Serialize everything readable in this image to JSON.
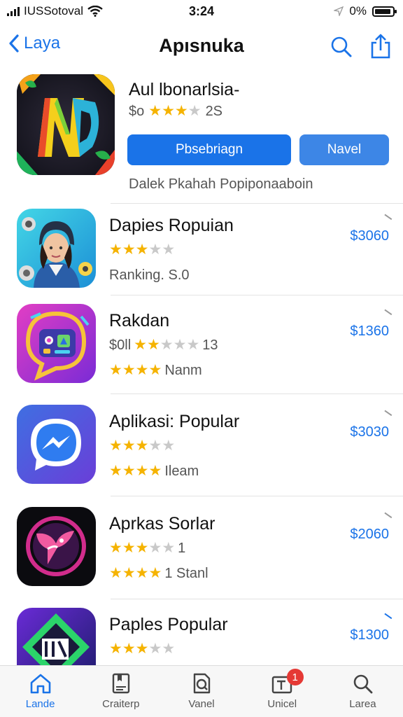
{
  "status_bar": {
    "carrier": "IUSSotoval",
    "time": "3:24",
    "battery": "0%"
  },
  "nav": {
    "back_label": "Laya",
    "title": "Apısnuka"
  },
  "featured": {
    "title": "Aul lbonarlsia-",
    "meta_prefix": "$o",
    "meta_count": "2S",
    "rating": 3,
    "primary_button": "Pbsebriagn",
    "secondary_button": "Navel",
    "subtitle": "Dalek Pkahah Popiponaaboin"
  },
  "apps": [
    {
      "name": "Dapies Ropuian",
      "price": "$3060",
      "rating": 3,
      "line2_text": "",
      "line3_text": "Ranking. S.0",
      "line3_stars": 0
    },
    {
      "name": "Rakdan",
      "price": "$1360",
      "rating": 2,
      "line2_prefix": "$0ll",
      "line2_text": "13",
      "line3_text": "Nanm",
      "line3_stars": 4
    },
    {
      "name": "Aplikasi: Popular",
      "price": "$3030",
      "rating": 3,
      "line2_text": "",
      "line3_text": "Ileam",
      "line3_stars": 4
    },
    {
      "name": "Aprkas Sorlar",
      "price": "$2060",
      "rating": 3,
      "line2_text": "1",
      "line3_text": "1 Stanl",
      "line3_stars": 4
    },
    {
      "name": "Paples Popular",
      "price": "$1300",
      "rating": 3,
      "line2_text": "",
      "line3_text": "",
      "line3_stars": 0
    }
  ],
  "tabs": [
    {
      "label": "Lande",
      "icon": "home-icon",
      "active": true
    },
    {
      "label": "Craiterp",
      "icon": "book-icon",
      "active": false
    },
    {
      "label": "Vanel",
      "icon": "search-doc-icon",
      "active": false
    },
    {
      "label": "Unicel",
      "icon": "updates-icon",
      "active": false,
      "badge": "1"
    },
    {
      "label": "Larea",
      "icon": "search-icon",
      "active": false
    }
  ],
  "colors": {
    "accent": "#1a73e8",
    "star": "#f5b301",
    "badge": "#e53935"
  }
}
